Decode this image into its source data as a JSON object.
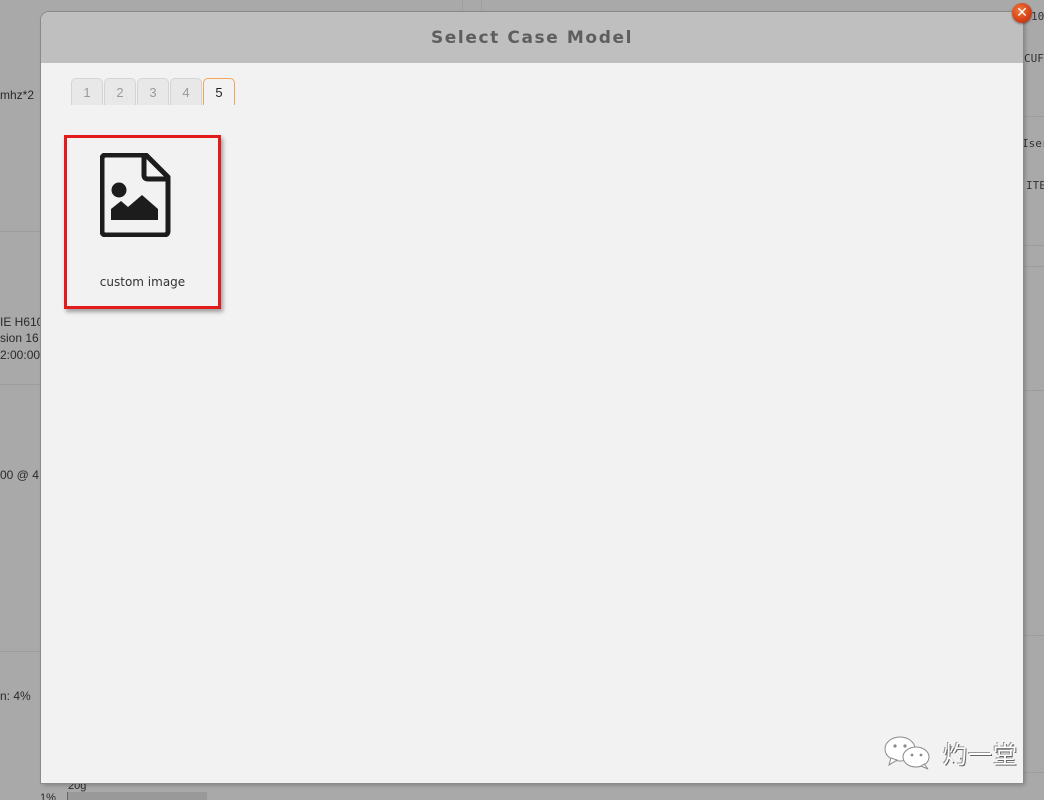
{
  "background": {
    "left_column_texts": [
      "mhz*2",
      "IE H610",
      "sion 16",
      "2:00:00",
      "00 @ 4",
      "n: 4%",
      "20g",
      "1%"
    ],
    "right_column_texts": [
      "10",
      "CUF",
      "Iser",
      "ITE"
    ]
  },
  "modal": {
    "title": "Select Case Model",
    "close_icon": "close-icon",
    "tabs": [
      {
        "label": "1",
        "active": false
      },
      {
        "label": "2",
        "active": false
      },
      {
        "label": "3",
        "active": false
      },
      {
        "label": "4",
        "active": false
      },
      {
        "label": "5",
        "active": true
      }
    ],
    "items": [
      {
        "label": "custom image",
        "icon": "image-file-icon",
        "selected": true
      }
    ]
  },
  "colors": {
    "accent_tab_border": "#f0a55a",
    "selection_border": "#e41b1b",
    "close_button": "#d8431a",
    "header_bg": "#bfbfbf",
    "body_bg": "#f2f2f2"
  },
  "watermark": {
    "icon": "wechat-icon",
    "text": "灼一堂"
  }
}
